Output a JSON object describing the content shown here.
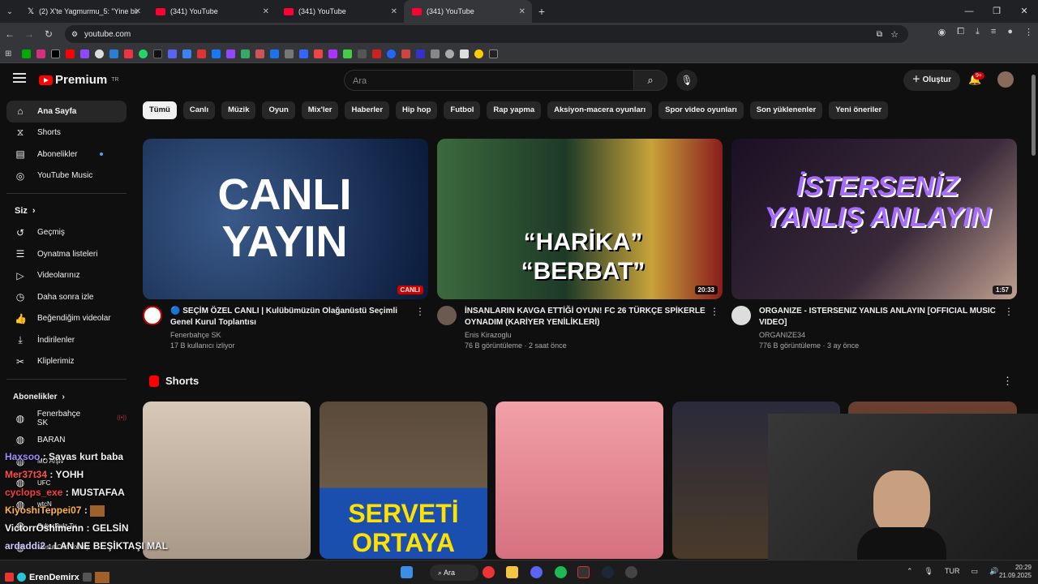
{
  "browser": {
    "tabs": [
      {
        "label": "(2) X'te Yagmurmu_5: \"Yine bir",
        "icon": "x-icon",
        "active": false
      },
      {
        "label": "(341) YouTube",
        "icon": "youtube-icon",
        "active": false
      },
      {
        "label": "(341) YouTube",
        "icon": "youtube-icon",
        "active": false
      },
      {
        "label": "(341) YouTube",
        "icon": "youtube-icon",
        "active": true
      }
    ],
    "url": "youtube.com"
  },
  "youtube": {
    "logo": "Premium",
    "logo_region": "TR",
    "search_placeholder": "Ara",
    "create_label": "Oluştur",
    "notification_count": "9+"
  },
  "sidebar": {
    "main": [
      {
        "label": "Ana Sayfa",
        "icon": "home-icon"
      },
      {
        "label": "Shorts",
        "icon": "shorts-icon"
      },
      {
        "label": "Abonelikler",
        "icon": "subscriptions-icon"
      },
      {
        "label": "YouTube Music",
        "icon": "music-icon"
      }
    ],
    "you_header": "Siz",
    "you": [
      {
        "label": "Geçmiş",
        "icon": "history-icon"
      },
      {
        "label": "Oynatma listeleri",
        "icon": "playlist-icon"
      },
      {
        "label": "Videolarınız",
        "icon": "video-icon"
      },
      {
        "label": "Daha sonra izle",
        "icon": "clock-icon"
      },
      {
        "label": "Beğendiğim videolar",
        "icon": "like-icon"
      },
      {
        "label": "İndirilenler",
        "icon": "download-icon"
      },
      {
        "label": "Kliplerimiz",
        "icon": "scissors-icon"
      }
    ],
    "subs_header": "Abonelikler",
    "subs": [
      "Fenerbahçe SK",
      "BARAN",
      "MO Arşiv",
      "UFC",
      "wtcN",
      "CyberRulz Tv",
      "Mesut Can Tomay"
    ]
  },
  "chips": [
    "Tümü",
    "Canlı",
    "Müzik",
    "Oyun",
    "Mix'ler",
    "Haberler",
    "Hip hop",
    "Futbol",
    "Rap yapma",
    "Aksiyon-macera oyunları",
    "Spor video oyunları",
    "Son yüklenenler",
    "Yeni öneriler"
  ],
  "videos": [
    {
      "title": "🔵 SEÇİM ÖZEL CANLI | Kulübümüzün Olağanüstü Seçimli Genel Kurul Toplantısı",
      "channel": "Fenerbahçe SK",
      "stats": "17 B kullanıcı izliyor",
      "badge": "CANLI",
      "thumb_text": "CANLI YAYIN"
    },
    {
      "title": "İNSANLARIN KAVGA ETTİĞİ OYUN! FC 26 TÜRKÇE SPİKERLE OYNADIM (KARİYER YENİLİKLERİ)",
      "channel": "Enis Kirazoglu",
      "stats": "76 B görüntüleme · 2 saat önce",
      "badge": "20:33",
      "thumb_text": "“HARİKA” “BERBAT”"
    },
    {
      "title": "ORGANIZE - ISTERSENIZ YANLIS ANLAYIN [OFFICIAL MUSIC VIDEO]",
      "channel": "ORGANIZE34",
      "stats": "776 B görüntüleme · 3 ay önce",
      "badge": "1:57",
      "thumb_text": "İSTERSENİZ YANLIŞ ANLAYIN"
    }
  ],
  "shorts_label": "Shorts",
  "shorts_thumb_text": "SERVETİ ORTAYA",
  "chat": [
    {
      "user": "Haxsoo",
      "msg": "Savas kurt baba",
      "color": "#9b8cff"
    },
    {
      "user": "Mer37t34",
      "msg": "YOHH",
      "color": "#ff4d4d"
    },
    {
      "user": "cyclops_exe",
      "msg": "MUSTAFAA",
      "color": "#ff3b3b"
    },
    {
      "user": "KiyoshiTeppei07",
      "msg": "",
      "color": "#ffb347"
    },
    {
      "user": "VictorrOshimenn",
      "msg": "GELSİN",
      "color": "#ffffff"
    },
    {
      "user": "ardaddi2",
      "msg": "LAN NE BEŞİKTAŞI MAL",
      "color": "#c9c9ff"
    }
  ],
  "streamer": "ErenDemirx",
  "taskbar": {
    "search": "Ara",
    "lang": "TUR",
    "time": "20:29",
    "date": "21.09.2025"
  }
}
